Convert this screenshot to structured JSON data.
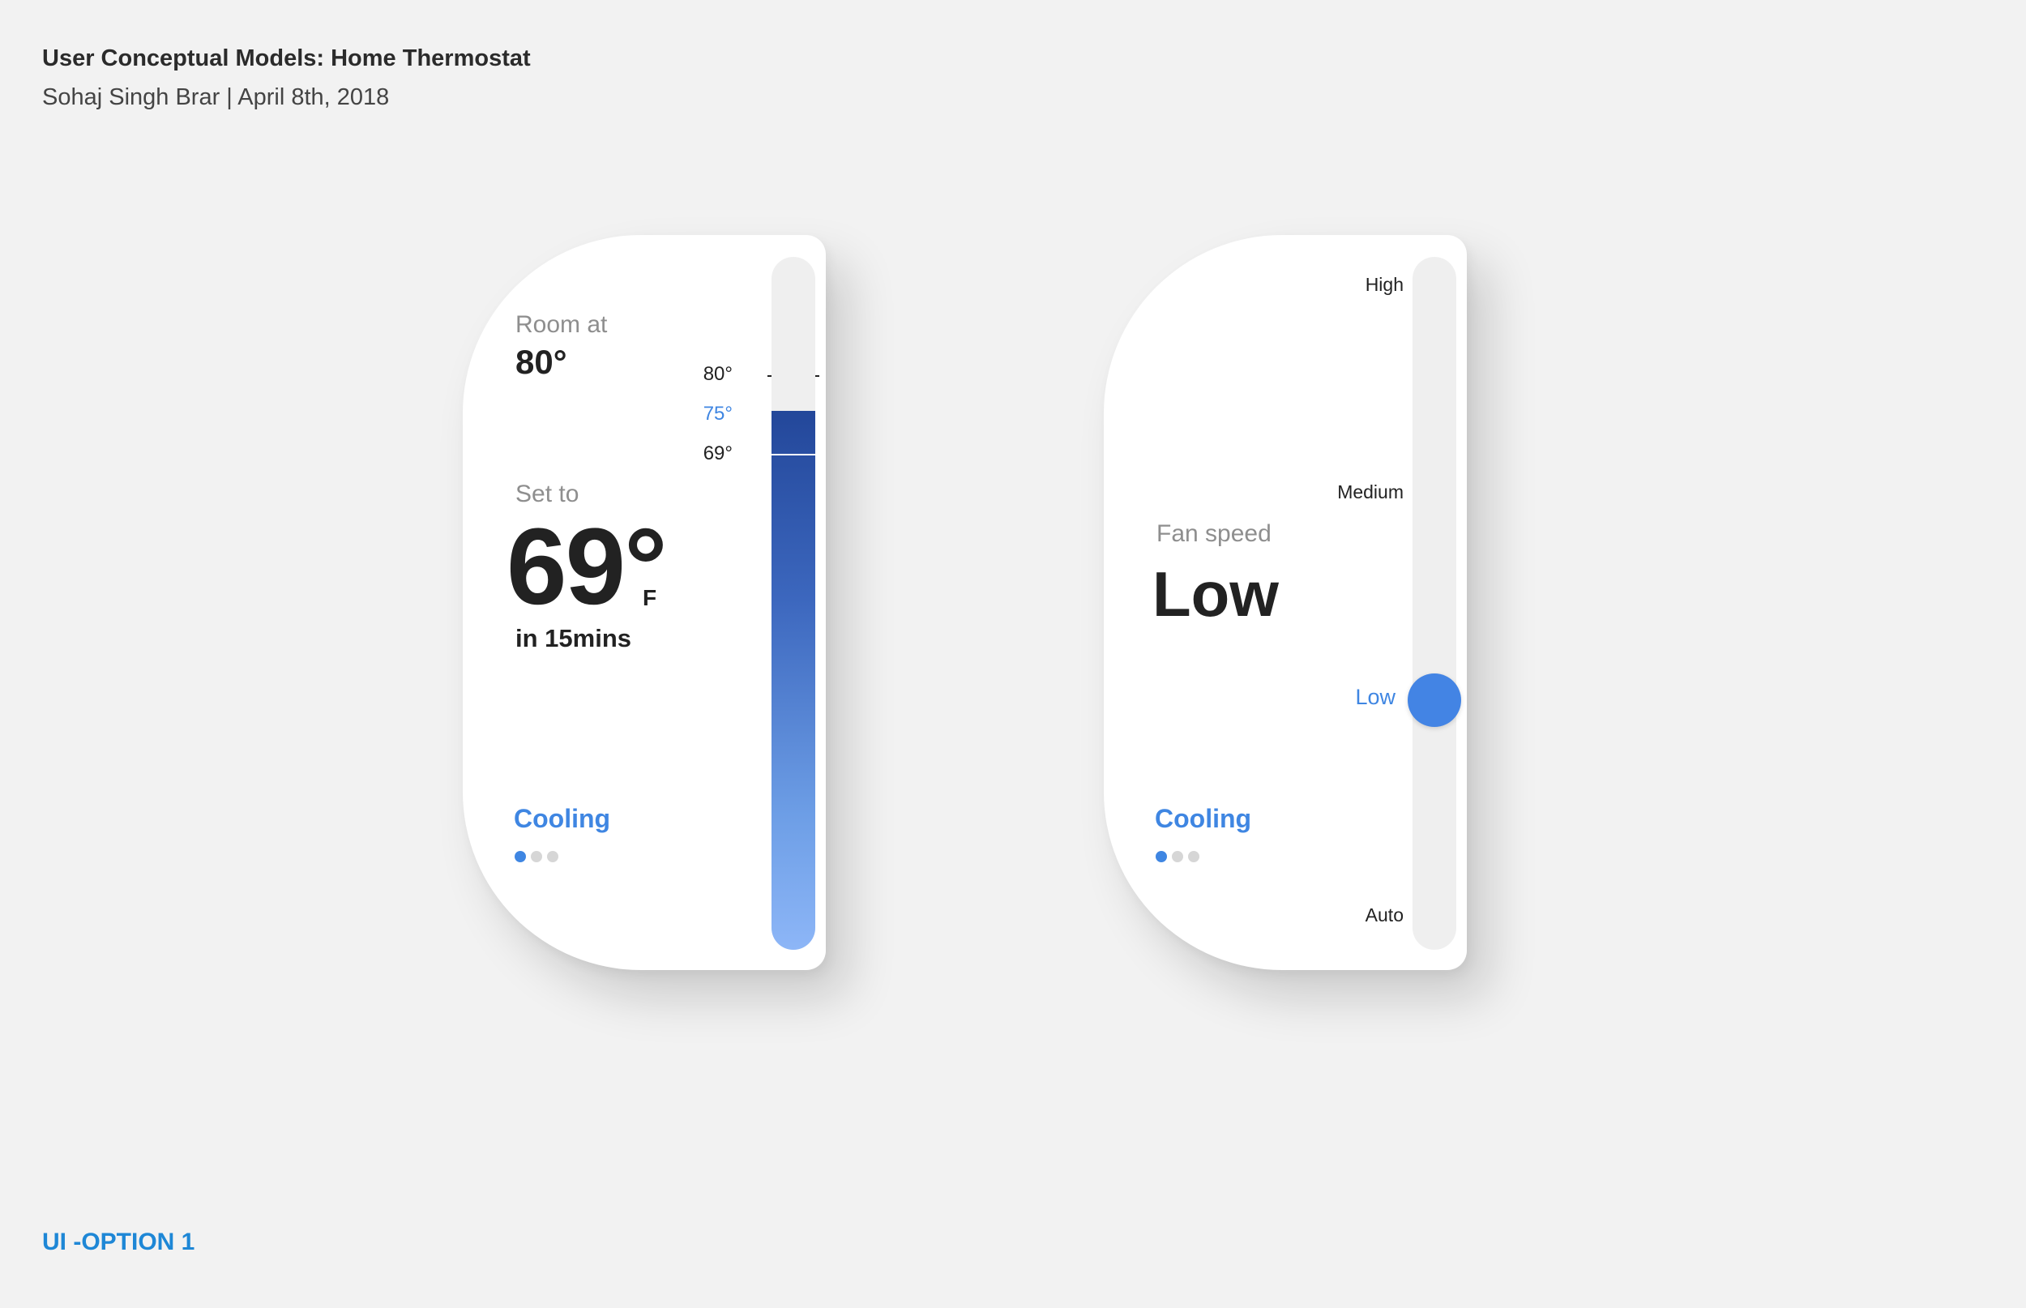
{
  "header": {
    "title": "User Conceptual Models: Home Thermostat",
    "subtitle": "Sohaj Singh Brar | April 8th, 2018"
  },
  "footer": {
    "option_label": "UI -OPTION 1"
  },
  "temperature_card": {
    "room_label": "Room at",
    "room_value": "80°",
    "set_label": "Set to",
    "set_value": "69°",
    "unit": "F",
    "eta": "in 15mins",
    "mode": "Cooling",
    "page_dots": {
      "count": 3,
      "active_index": 0
    },
    "slider": {
      "min": 55,
      "max": 90,
      "room_temp": 80,
      "fill_top_temp": 75,
      "setpoint": 69,
      "tick_labels": {
        "room": "80°",
        "fill_top": "75°",
        "setpoint": "69°"
      }
    },
    "colors": {
      "accent": "#3f86e2",
      "fill_dark": "#23479a",
      "fill_light": "#8db6f7"
    }
  },
  "fan_card": {
    "fan_label": "Fan speed",
    "fan_value": "Low",
    "mode": "Cooling",
    "page_dots": {
      "count": 3,
      "active_index": 0
    },
    "speeds": [
      "High",
      "Medium",
      "Low",
      "Auto"
    ],
    "selected_speed": "Low",
    "colors": {
      "accent": "#3f86e2",
      "knob": "#4384e4"
    }
  }
}
